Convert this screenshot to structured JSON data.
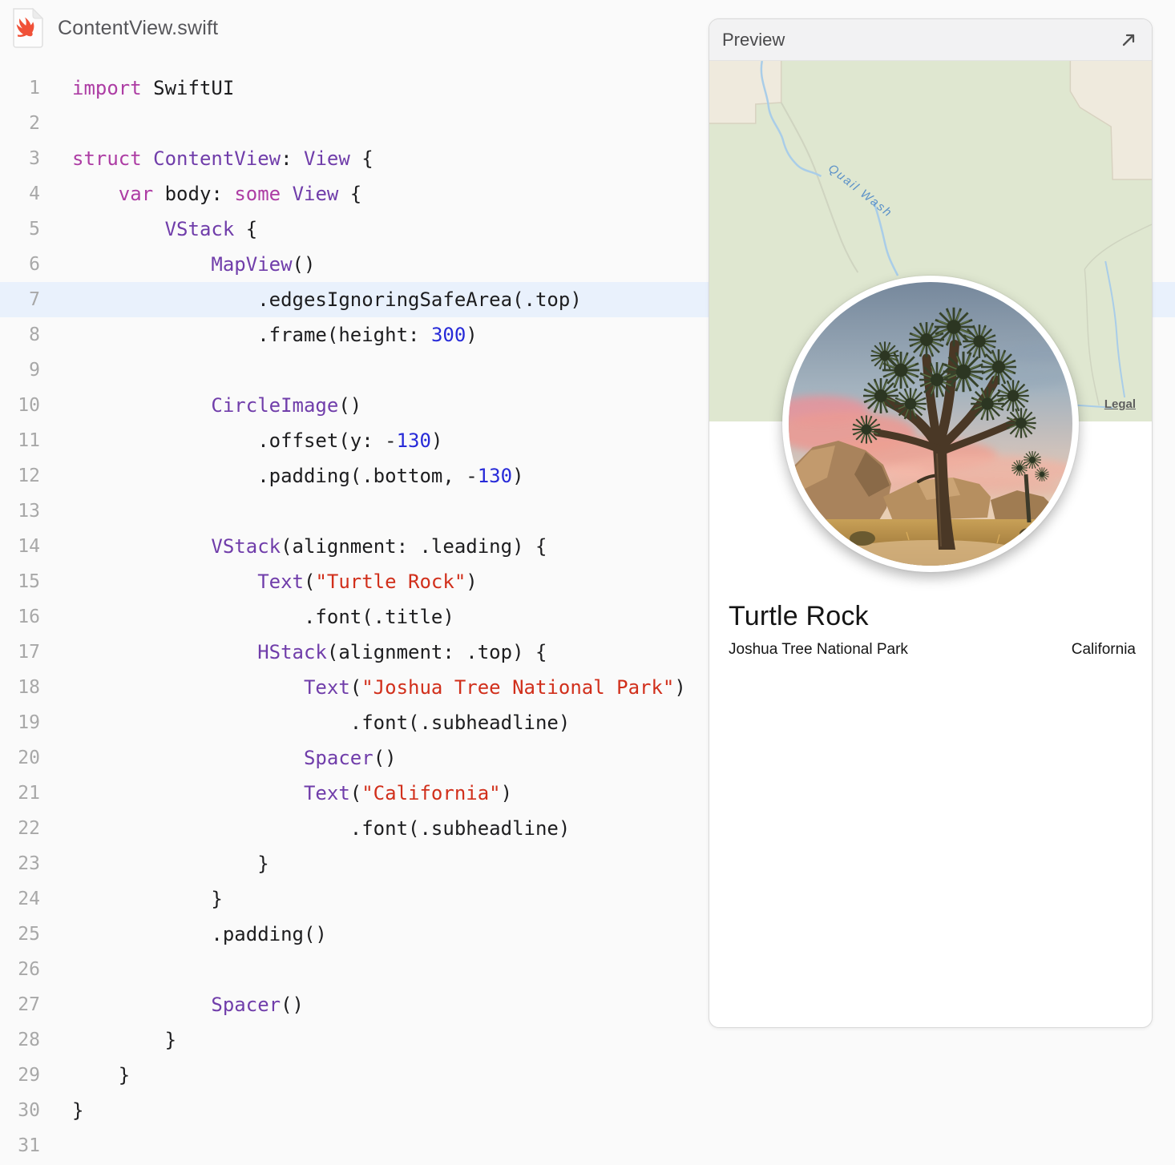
{
  "colors": {
    "keyword": "#ad3da4",
    "type": "#703daa",
    "number": "#272ad8",
    "string": "#d12f1b",
    "plain": "#1d1d1f",
    "highlight_line": "#e9f1fc",
    "map_green": "#dfe7d0",
    "map_beige": "#efeadd",
    "creek_blue": "#a9cde8",
    "swift_orange": "#f05138"
  },
  "file": {
    "title": "ContentView.swift"
  },
  "editor": {
    "lines": [
      {
        "n": 1,
        "hl": false,
        "tokens": [
          [
            "kw",
            "import"
          ],
          [
            "pl",
            " SwiftUI"
          ]
        ]
      },
      {
        "n": 2,
        "hl": false,
        "tokens": []
      },
      {
        "n": 3,
        "hl": false,
        "tokens": [
          [
            "kw",
            "struct"
          ],
          [
            "pl",
            " "
          ],
          [
            "ty",
            "ContentView"
          ],
          [
            "pl",
            ": "
          ],
          [
            "ty",
            "View"
          ],
          [
            "pl",
            " {"
          ]
        ]
      },
      {
        "n": 4,
        "hl": false,
        "tokens": [
          [
            "pl",
            "    "
          ],
          [
            "kw",
            "var"
          ],
          [
            "pl",
            " body: "
          ],
          [
            "kw",
            "some"
          ],
          [
            "pl",
            " "
          ],
          [
            "ty",
            "View"
          ],
          [
            "pl",
            " {"
          ]
        ]
      },
      {
        "n": 5,
        "hl": false,
        "tokens": [
          [
            "pl",
            "        "
          ],
          [
            "ty",
            "VStack"
          ],
          [
            "pl",
            " {"
          ]
        ]
      },
      {
        "n": 6,
        "hl": false,
        "tokens": [
          [
            "pl",
            "            "
          ],
          [
            "ty",
            "MapView"
          ],
          [
            "pl",
            "()"
          ]
        ]
      },
      {
        "n": 7,
        "hl": true,
        "tokens": [
          [
            "pl",
            "                .edgesIgnoringSafeArea(.top)"
          ]
        ]
      },
      {
        "n": 8,
        "hl": false,
        "tokens": [
          [
            "pl",
            "                .frame(height: "
          ],
          [
            "num",
            "300"
          ],
          [
            "pl",
            ")"
          ]
        ]
      },
      {
        "n": 9,
        "hl": false,
        "tokens": []
      },
      {
        "n": 10,
        "hl": false,
        "tokens": [
          [
            "pl",
            "            "
          ],
          [
            "ty",
            "CircleImage"
          ],
          [
            "pl",
            "()"
          ]
        ]
      },
      {
        "n": 11,
        "hl": false,
        "tokens": [
          [
            "pl",
            "                .offset(y: -"
          ],
          [
            "num",
            "130"
          ],
          [
            "pl",
            ")"
          ]
        ]
      },
      {
        "n": 12,
        "hl": false,
        "tokens": [
          [
            "pl",
            "                .padding(.bottom, -"
          ],
          [
            "num",
            "130"
          ],
          [
            "pl",
            ")"
          ]
        ]
      },
      {
        "n": 13,
        "hl": false,
        "tokens": []
      },
      {
        "n": 14,
        "hl": false,
        "tokens": [
          [
            "pl",
            "            "
          ],
          [
            "ty",
            "VStack"
          ],
          [
            "pl",
            "(alignment: .leading) {"
          ]
        ]
      },
      {
        "n": 15,
        "hl": false,
        "tokens": [
          [
            "pl",
            "                "
          ],
          [
            "ty",
            "Text"
          ],
          [
            "pl",
            "("
          ],
          [
            "str",
            "\"Turtle Rock\""
          ],
          [
            "pl",
            ")"
          ]
        ]
      },
      {
        "n": 16,
        "hl": false,
        "tokens": [
          [
            "pl",
            "                    .font(.title)"
          ]
        ]
      },
      {
        "n": 17,
        "hl": false,
        "tokens": [
          [
            "pl",
            "                "
          ],
          [
            "ty",
            "HStack"
          ],
          [
            "pl",
            "(alignment: .top) {"
          ]
        ]
      },
      {
        "n": 18,
        "hl": false,
        "tokens": [
          [
            "pl",
            "                    "
          ],
          [
            "ty",
            "Text"
          ],
          [
            "pl",
            "("
          ],
          [
            "str",
            "\"Joshua Tree National Park\""
          ],
          [
            "pl",
            ")"
          ]
        ]
      },
      {
        "n": 19,
        "hl": false,
        "tokens": [
          [
            "pl",
            "                        .font(.subheadline)"
          ]
        ]
      },
      {
        "n": 20,
        "hl": false,
        "tokens": [
          [
            "pl",
            "                    "
          ],
          [
            "ty",
            "Spacer"
          ],
          [
            "pl",
            "()"
          ]
        ]
      },
      {
        "n": 21,
        "hl": false,
        "tokens": [
          [
            "pl",
            "                    "
          ],
          [
            "ty",
            "Text"
          ],
          [
            "pl",
            "("
          ],
          [
            "str",
            "\"California\""
          ],
          [
            "pl",
            ")"
          ]
        ]
      },
      {
        "n": 22,
        "hl": false,
        "tokens": [
          [
            "pl",
            "                        .font(.subheadline)"
          ]
        ]
      },
      {
        "n": 23,
        "hl": false,
        "tokens": [
          [
            "pl",
            "                }"
          ]
        ]
      },
      {
        "n": 24,
        "hl": false,
        "tokens": [
          [
            "pl",
            "            }"
          ]
        ]
      },
      {
        "n": 25,
        "hl": false,
        "tokens": [
          [
            "pl",
            "            .padding()"
          ]
        ]
      },
      {
        "n": 26,
        "hl": false,
        "tokens": []
      },
      {
        "n": 27,
        "hl": false,
        "tokens": [
          [
            "pl",
            "            "
          ],
          [
            "ty",
            "Spacer"
          ],
          [
            "pl",
            "()"
          ]
        ]
      },
      {
        "n": 28,
        "hl": false,
        "tokens": [
          [
            "pl",
            "        }"
          ]
        ]
      },
      {
        "n": 29,
        "hl": false,
        "tokens": [
          [
            "pl",
            "    }"
          ]
        ]
      },
      {
        "n": 30,
        "hl": false,
        "tokens": [
          [
            "pl",
            "}"
          ]
        ]
      },
      {
        "n": 31,
        "hl": false,
        "tokens": []
      }
    ]
  },
  "preview": {
    "title": "Preview",
    "map": {
      "wash_label": "Quail Wash",
      "legal_label": "Legal"
    },
    "card": {
      "title": "Turtle Rock",
      "park": "Joshua Tree National Park",
      "state": "California"
    }
  }
}
